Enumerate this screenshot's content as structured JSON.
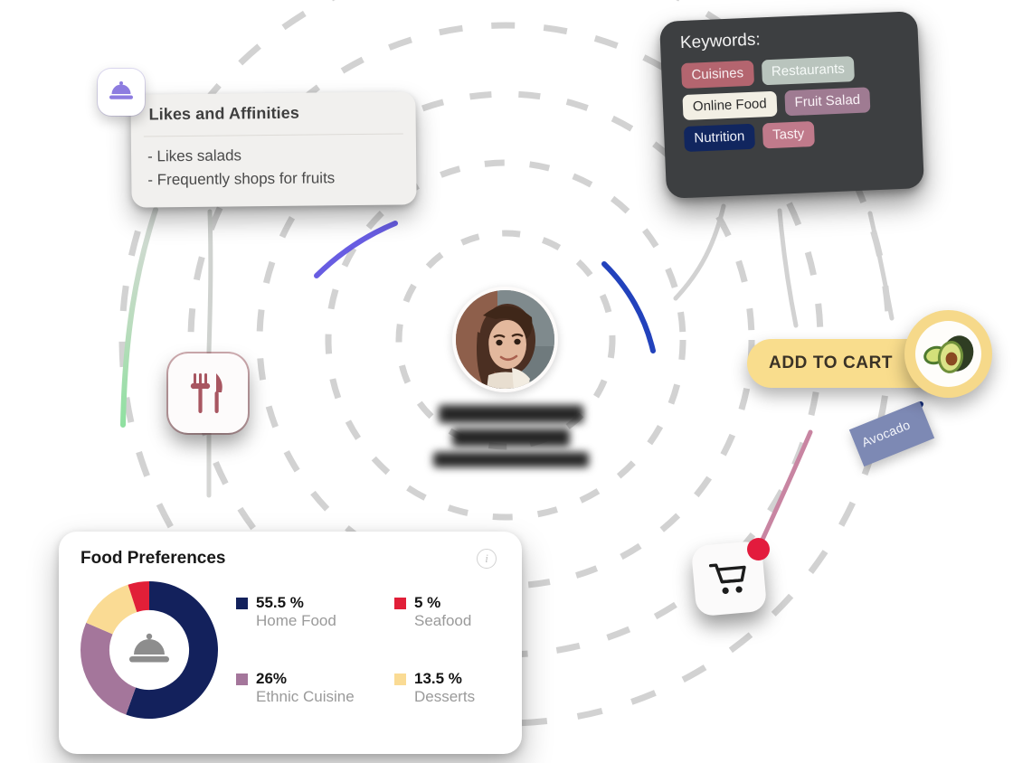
{
  "likes_card": {
    "title": "Likes and Affinities",
    "items": [
      "- Likes salads",
      "- Frequently shops for fruits"
    ],
    "badge_icon": "cloche-icon"
  },
  "keywords_card": {
    "title": "Keywords:",
    "chips": [
      {
        "label": "Cuisines",
        "bg": "#b4656f",
        "fg": "#f7eef0"
      },
      {
        "label": "Restaurants",
        "bg": "#b9c4bd",
        "fg": "#f6faf8"
      },
      {
        "label": "Online Food",
        "bg": "#f2efe4",
        "fg": "#2b2b2b"
      },
      {
        "label": "Fruit Salad",
        "bg": "#9f7b92",
        "fg": "#f9f1f6"
      },
      {
        "label": "Nutrition",
        "bg": "#11265f",
        "fg": "#f2f4fb"
      },
      {
        "label": "Tasty",
        "bg": "#c07a8b",
        "fg": "#fbf1f4"
      }
    ]
  },
  "center": {
    "avatar_alt": "user-avatar",
    "name_redacted": true,
    "name_lines": [
      "",
      "",
      ""
    ]
  },
  "nodes": {
    "cutlery_icon": "fork-and-knife-icon",
    "cart_icon": "shopping-cart-icon",
    "cart_badge": "",
    "avocado_icon": "avocado-icon"
  },
  "add_to_cart": {
    "label": "ADD TO CART",
    "accent": "#f9dd8d"
  },
  "product_tag": {
    "label": "Avocado",
    "bg": "#7d89b4"
  },
  "food_card": {
    "title": "Food Preferences",
    "info_glyph": "i"
  },
  "chart_data": {
    "type": "pie",
    "title": "Food Preferences",
    "categories": [
      "Home Food",
      "Ethnic Cuisine",
      "Desserts",
      "Seafood"
    ],
    "values": [
      55.5,
      26,
      13.5,
      5
    ],
    "display_values": [
      "55.5 %",
      "26%",
      "13.5 %",
      "5 %"
    ],
    "colors": [
      "#13215c",
      "#a4769b",
      "#fadb94",
      "#e11f38"
    ],
    "donut": true,
    "inner_radius_ratio": 0.58,
    "legend": "right",
    "legend_order": [
      "Home Food",
      "Seafood",
      "Ethnic Cuisine",
      "Desserts"
    ],
    "units": "%",
    "center_icon": "cloche-icon"
  },
  "orbits": {
    "center": [
      559,
      376
    ],
    "rings": [
      118,
      196,
      272,
      348,
      424
    ],
    "dash_color": "#d2d2d2",
    "arc_accents": [
      {
        "color": "#5b4fe0",
        "note": "purple arc upper-left"
      },
      {
        "color": "#1638b8",
        "note": "blue arc upper-right"
      },
      {
        "color": "#9fd8a8",
        "note": "green connector left"
      },
      {
        "color": "#c07fa8",
        "note": "pink connector to cart"
      }
    ]
  }
}
